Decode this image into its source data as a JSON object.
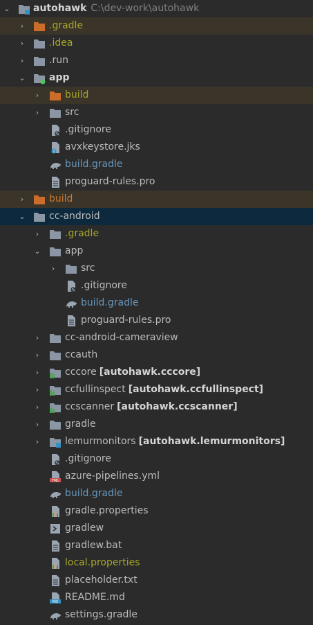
{
  "project": {
    "name": "autohawk",
    "path": "C:\\dev-work\\autohawk"
  },
  "rows": [
    {
      "label": "autohawk",
      "extra": "C:\\dev-work\\autohawk"
    },
    {
      "label": ".gradle"
    },
    {
      "label": ".idea"
    },
    {
      "label": ".run"
    },
    {
      "label": "app"
    },
    {
      "label": "build"
    },
    {
      "label": "src"
    },
    {
      "label": ".gitignore"
    },
    {
      "label": "avxkeystore.jks"
    },
    {
      "label": "build.gradle"
    },
    {
      "label": "proguard-rules.pro"
    },
    {
      "label": "build"
    },
    {
      "label": "cc-android"
    },
    {
      "label": ".gradle"
    },
    {
      "label": "app"
    },
    {
      "label": "src"
    },
    {
      "label": ".gitignore"
    },
    {
      "label": "build.gradle"
    },
    {
      "label": "proguard-rules.pro"
    },
    {
      "label": "cc-android-cameraview"
    },
    {
      "label": "ccauth"
    },
    {
      "label": "cccore",
      "extra": "[autohawk.cccore]"
    },
    {
      "label": "ccfullinspect",
      "extra": "[autohawk.ccfullinspect]"
    },
    {
      "label": "ccscanner",
      "extra": "[autohawk.ccscanner]"
    },
    {
      "label": "gradle"
    },
    {
      "label": "lemurmonitors",
      "extra": "[autohawk.lemurmonitors]"
    },
    {
      "label": ".gitignore"
    },
    {
      "label": "azure-pipelines.yml"
    },
    {
      "label": "build.gradle"
    },
    {
      "label": "gradle.properties"
    },
    {
      "label": "gradlew"
    },
    {
      "label": "gradlew.bat"
    },
    {
      "label": "local.properties"
    },
    {
      "label": "placeholder.txt"
    },
    {
      "label": "README.md"
    },
    {
      "label": "settings.gradle"
    }
  ],
  "icons": {
    "0": "module-folder-icon",
    "1": "excluded-folder-icon",
    "2": "folder-icon",
    "3": "folder-icon",
    "4": "android-module-folder-icon",
    "5": "excluded-folder-icon",
    "6": "folder-icon",
    "7": "gitignore-file-icon",
    "8": "keystore-file-icon",
    "9": "gradle-icon",
    "10": "text-file-icon",
    "11": "excluded-folder-icon",
    "12": "folder-icon",
    "13": "folder-icon",
    "14": "folder-icon",
    "15": "folder-icon",
    "16": "gitignore-file-icon",
    "17": "gradle-icon",
    "18": "text-file-icon",
    "19": "folder-icon",
    "20": "folder-icon",
    "21": "library-module-folder-icon",
    "22": "library-module-folder-icon",
    "23": "library-module-folder-icon",
    "24": "folder-icon",
    "25": "module-folder-icon",
    "26": "gitignore-file-icon",
    "27": "yml-file-icon",
    "28": "gradle-icon",
    "29": "properties-file-icon",
    "30": "shell-script-icon",
    "31": "text-file-icon",
    "32": "properties-file-icon",
    "33": "text-file-icon",
    "34": "markdown-file-icon",
    "35": "gradle-icon"
  },
  "colors": {
    "background": "#2b2b2b",
    "selected_row": "#0d293e",
    "excluded_row": "#3a3429",
    "folder": "#8a96a3",
    "excluded_folder": "#cc6c2b",
    "library_badge": "#49a74d",
    "module_badge": "#3592c4",
    "android_badge": "#4ec35c",
    "orange_text": "#cc7832",
    "olive_text": "#a5a52a",
    "blue_text": "#6897bb"
  }
}
